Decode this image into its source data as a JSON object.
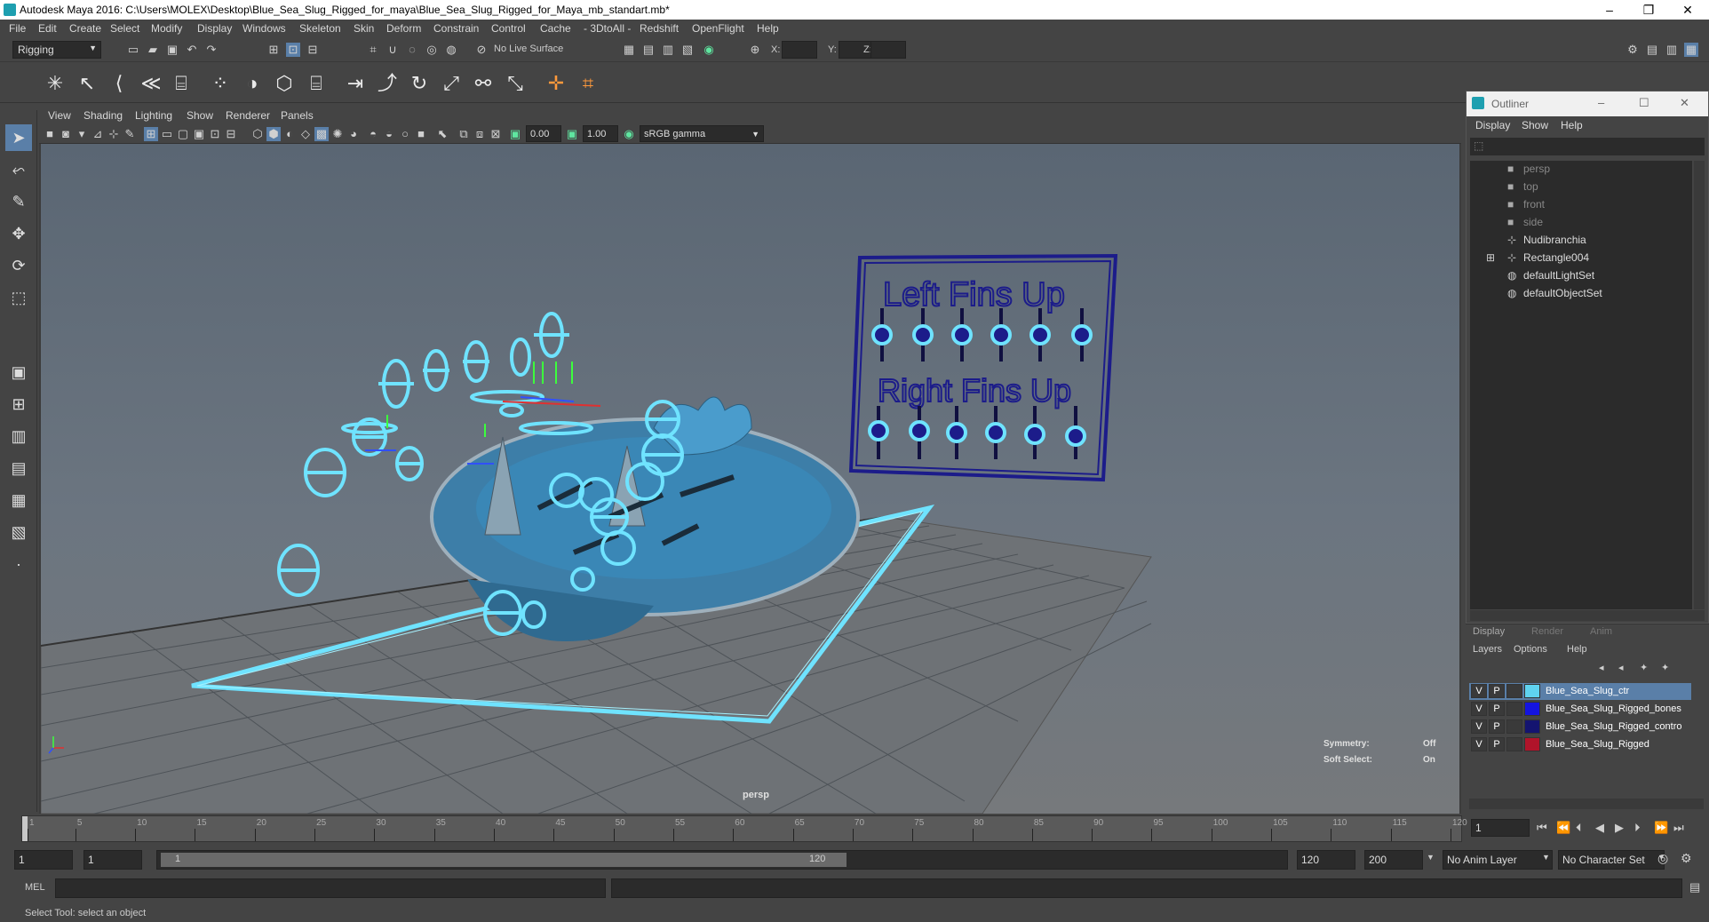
{
  "window": {
    "title": "Autodesk Maya 2016: C:\\Users\\MOLEX\\Desktop\\Blue_Sea_Slug_Rigged_for_maya\\Blue_Sea_Slug_Rigged_for_Maya_mb_standart.mb*",
    "minimize": "–",
    "restore": "❐",
    "close": "✕"
  },
  "menubar": [
    "File",
    "Edit",
    "Create",
    "Select",
    "Modify",
    "Display",
    "Windows",
    "Skeleton",
    "Skin",
    "Deform",
    "Constrain",
    "Control",
    "Cache",
    "- 3DtoAll -",
    "Redshift",
    "OpenFlight",
    "Help"
  ],
  "statusline": {
    "menuset": "Rigging",
    "live_surface": "No Live Surface",
    "x_label": "X:",
    "y_label": "Y:",
    "z_label": "Z:"
  },
  "viewport": {
    "menu": [
      "View",
      "Shading",
      "Lighting",
      "Show",
      "Renderer",
      "Panels"
    ],
    "exposure": "0.00",
    "gamma": "1.00",
    "color_space": "sRGB gamma",
    "camera_label": "persp",
    "symmetry_label": "Symmetry:",
    "symmetry_value": "Off",
    "soft_select_label": "Soft Select:",
    "soft_select_value": "On",
    "board_text_1": "Left Fins Up",
    "board_text_2": "Right Fins Up"
  },
  "outliner": {
    "title": "Outliner",
    "menu": [
      "Display",
      "Show",
      "Help"
    ],
    "items": [
      {
        "label": "persp",
        "dim": true
      },
      {
        "label": "top",
        "dim": true
      },
      {
        "label": "front",
        "dim": true
      },
      {
        "label": "side",
        "dim": true
      },
      {
        "label": "Nudibranchia",
        "dim": false
      },
      {
        "label": "Rectangle004",
        "dim": false
      },
      {
        "label": "defaultLightSet",
        "dim": false
      },
      {
        "label": "defaultObjectSet",
        "dim": false
      }
    ]
  },
  "layers": {
    "tabs": [
      "Display",
      "Render",
      "Anim"
    ],
    "menu": [
      "Layers",
      "Options",
      "Help"
    ],
    "rows": [
      {
        "v": "V",
        "p": "P",
        "color": "#5fd3f0",
        "name": "Blue_Sea_Slug_ctr"
      },
      {
        "v": "V",
        "p": "P",
        "color": "#1414e0",
        "name": "Blue_Sea_Slug_Rigged_bones"
      },
      {
        "v": "V",
        "p": "P",
        "color": "#141470",
        "name": "Blue_Sea_Slug_Rigged_contro"
      },
      {
        "v": "V",
        "p": "P",
        "color": "#b0142a",
        "name": "Blue_Sea_Slug_Rigged"
      }
    ]
  },
  "timeline": {
    "ticks": [
      "1",
      "5",
      "10",
      "15",
      "20",
      "25",
      "30",
      "35",
      "40",
      "45",
      "50",
      "55",
      "60",
      "65",
      "70",
      "75",
      "80",
      "85",
      "90",
      "95",
      "100",
      "105",
      "110",
      "115",
      "120"
    ],
    "current_frame": "1"
  },
  "range": {
    "start": "1",
    "playback_start": "1",
    "slider_start": "1",
    "slider_end": "120",
    "playback_end": "120",
    "end": "200",
    "anim_layer": "No Anim Layer",
    "character_set": "No Character Set"
  },
  "cmdline": {
    "label": "MEL"
  },
  "helpline": {
    "text": "Select Tool: select an object"
  }
}
